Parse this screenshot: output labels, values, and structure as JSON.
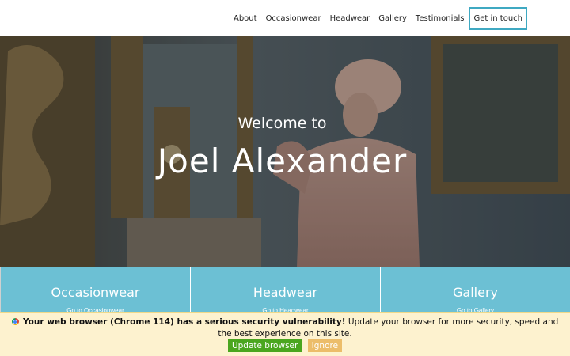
{
  "nav": {
    "items": [
      "About",
      "Occasionwear",
      "Headwear",
      "Gallery",
      "Testimonials"
    ],
    "cta": "Get in touch"
  },
  "hero": {
    "subtitle": "Welcome to",
    "title": "Joel Alexander"
  },
  "tiles": [
    {
      "title": "Occasionwear",
      "link": "Go to Occasionwear"
    },
    {
      "title": "Headwear",
      "link": "Go to Headwear"
    },
    {
      "title": "Gallery",
      "link": "Go to Gallery"
    }
  ],
  "banner": {
    "bold_text": "Your web browser (Chrome 114) has a serious security vulnerability!",
    "text": "Update your browser for more security, speed and the best experience on this site.",
    "update_label": "Update browser",
    "ignore_label": "Ignore"
  },
  "colors": {
    "accent": "#3fa9c2",
    "tile": "#6cc0d4",
    "banner": "#fdf2cf",
    "update_button": "#4aa61f",
    "ignore_button": "#ecbd6a"
  }
}
